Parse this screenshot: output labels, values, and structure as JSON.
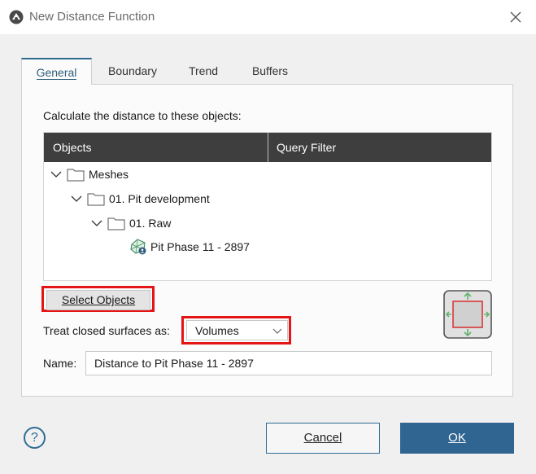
{
  "window": {
    "title": "New Distance Function"
  },
  "tabs": [
    {
      "label": "General",
      "active": true
    },
    {
      "label": "Boundary",
      "active": false
    },
    {
      "label": "Trend",
      "active": false
    },
    {
      "label": "Buffers",
      "active": false
    }
  ],
  "general": {
    "calc_label": "Calculate the distance to these objects:",
    "tree": {
      "columns": [
        "Objects",
        "Query Filter"
      ],
      "nodes": [
        {
          "label": "Meshes",
          "icon": "folder-icon",
          "expanded": true
        },
        {
          "label": "01. Pit development",
          "icon": "folder-icon",
          "expanded": true
        },
        {
          "label": "01. Raw",
          "icon": "folder-icon",
          "expanded": true
        },
        {
          "label": "Pit Phase 11 - 2897",
          "icon": "mesh-icon"
        }
      ]
    },
    "select_objects_label": "Select Objects",
    "treat_label": "Treat closed surfaces as:",
    "treat_value": "Volumes",
    "name_label": "Name:",
    "name_value": "Distance to Pit Phase 11 - 2897"
  },
  "footer": {
    "help": "?",
    "cancel": "Cancel",
    "ok": "OK"
  },
  "colors": {
    "accent": "#2f6590",
    "highlight": "#e31515",
    "header": "#3e3e3e"
  }
}
